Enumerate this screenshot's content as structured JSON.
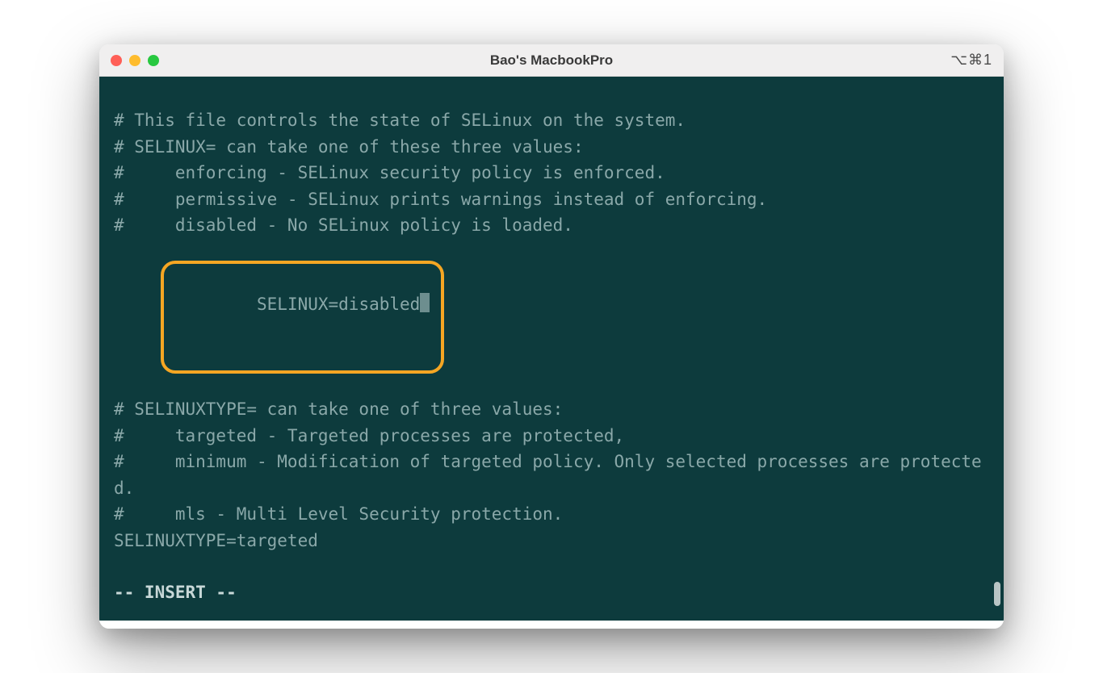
{
  "window": {
    "title": "Bao's MacbookPro",
    "shortcut": "⌥⌘1"
  },
  "file": {
    "lines": [
      "# This file controls the state of SELinux on the system.",
      "# SELINUX= can take one of these three values:",
      "#     enforcing - SELinux security policy is enforced.",
      "#     permissive - SELinux prints warnings instead of enforcing.",
      "#     disabled - No SELinux policy is loaded."
    ],
    "highlighted_line": "SELINUX=disabled",
    "lines_after": [
      "# SELINUXTYPE= can take one of three values:",
      "#     targeted - Targeted processes are protected,",
      "#     minimum - Modification of targeted policy. Only selected processes are protected.",
      "#     mls - Multi Level Security protection.",
      "SELINUXTYPE=targeted"
    ],
    "mode": "-- INSERT --"
  },
  "colors": {
    "terminal_bg": "#0d3b3d",
    "text": "#8aa8a9",
    "highlight_border": "#f5a623"
  }
}
